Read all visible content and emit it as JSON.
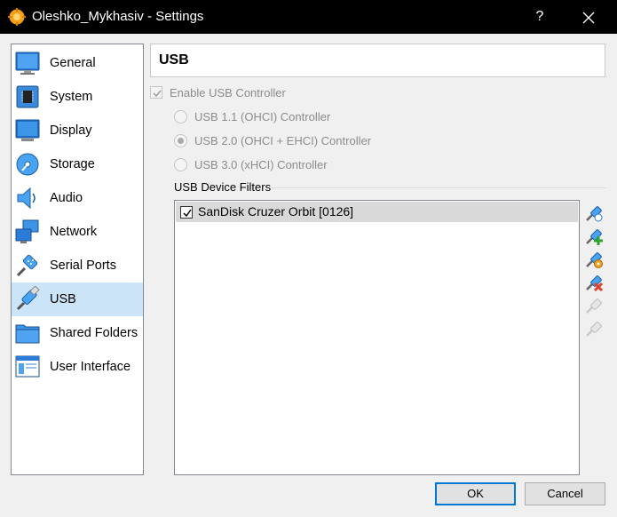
{
  "window": {
    "title": "Oleshko_Mykhasiv - Settings",
    "help_label": "?"
  },
  "sidebar": {
    "items": [
      {
        "label": "General"
      },
      {
        "label": "System"
      },
      {
        "label": "Display"
      },
      {
        "label": "Storage"
      },
      {
        "label": "Audio"
      },
      {
        "label": "Network"
      },
      {
        "label": "Serial Ports"
      },
      {
        "label": "USB",
        "selected": true
      },
      {
        "label": "Shared Folders"
      },
      {
        "label": "User Interface"
      }
    ]
  },
  "page": {
    "title": "USB"
  },
  "usb": {
    "enable_label": "Enable USB Controller",
    "enable_checked": true,
    "controllers": [
      {
        "label": "USB 1.1 (OHCI) Controller",
        "selected": false
      },
      {
        "label": "USB 2.0 (OHCI + EHCI) Controller",
        "selected": true
      },
      {
        "label": "USB 3.0 (xHCI) Controller",
        "selected": false
      }
    ],
    "filters_label": "USB Device Filters",
    "filters": [
      {
        "label": "SanDisk Cruzer Orbit [0126]",
        "checked": true
      }
    ]
  },
  "buttons": {
    "ok": "OK",
    "cancel": "Cancel"
  },
  "colors": {
    "selection": "#cce4f7",
    "accent": "#0078d7",
    "titlebar": "#000000"
  }
}
